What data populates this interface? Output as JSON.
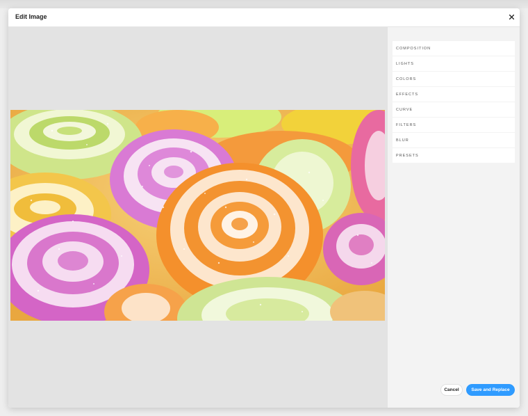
{
  "modal": {
    "title": "Edit Image",
    "close_icon": "close-icon"
  },
  "tools": [
    {
      "label": "COMPOSITION"
    },
    {
      "label": "LIGHTS"
    },
    {
      "label": "COLORS"
    },
    {
      "label": "EFFECTS"
    },
    {
      "label": "CURVE"
    },
    {
      "label": "FILTERS"
    },
    {
      "label": "BLUR"
    },
    {
      "label": "PRESETS"
    }
  ],
  "actions": {
    "cancel_label": "Cancel",
    "save_label": "Save and Replace"
  },
  "colors": {
    "accent": "#2f9bff",
    "canvas_bg": "#e3e3e3",
    "sidebar_bg": "#f3f3f3"
  }
}
